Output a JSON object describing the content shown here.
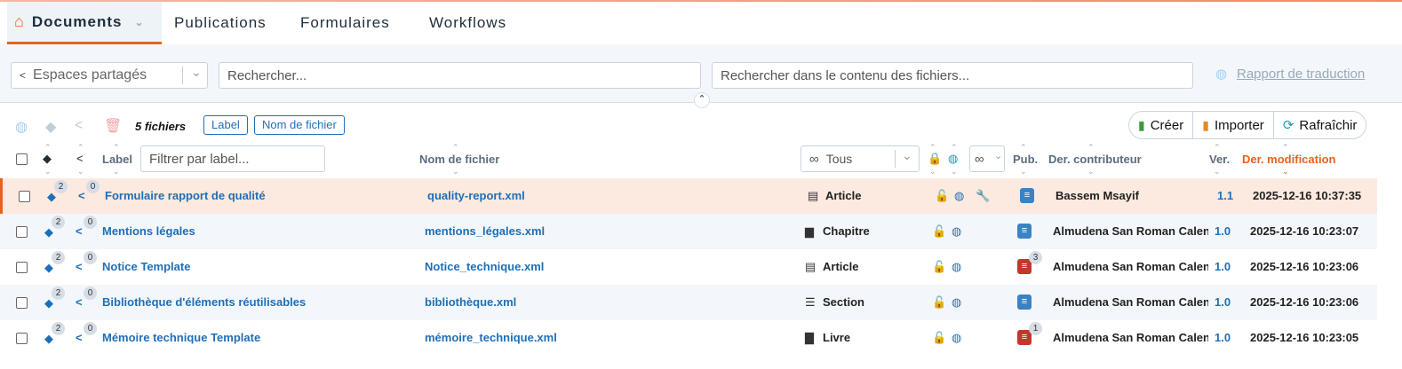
{
  "nav": {
    "tabs": [
      {
        "label": "Documents"
      },
      {
        "label": "Publications"
      },
      {
        "label": "Formulaires"
      },
      {
        "label": "Workflows"
      }
    ]
  },
  "toolbar": {
    "space_placeholder": "Espaces partagés",
    "search_placeholder": "Rechercher...",
    "content_search_placeholder": "Rechercher dans le contenu des fichiers...",
    "translation_report": "Rapport de traduction"
  },
  "list": {
    "count_label": "5 fichiers",
    "pill_label": "Label",
    "pill_filename": "Nom de fichier",
    "create": "Créer",
    "import": "Importer",
    "refresh": "Rafraîchir"
  },
  "columns": {
    "label": "Label",
    "label_filter_placeholder": "Filtrer par label...",
    "filename": "Nom de fichier",
    "type_filter": "Tous",
    "pub": "Pub.",
    "contributor": "Der. contributeur",
    "version": "Ver.",
    "modified": "Der. modification"
  },
  "rows": [
    {
      "tags": "2",
      "shares": "0",
      "label": "Formulaire rapport de qualité",
      "file": "quality-report.xml",
      "type": "Article",
      "pub_count": "",
      "contributor": "Bassem Msayif",
      "version": "1.1",
      "modified": "2025-12-16 10:37:35"
    },
    {
      "tags": "2",
      "shares": "0",
      "label": "Mentions légales",
      "file": "mentions_légales.xml",
      "type": "Chapitre",
      "pub_count": "",
      "contributor": "Almudena San Roman Calencc",
      "version": "1.0",
      "modified": "2025-12-16 10:23:07"
    },
    {
      "tags": "2",
      "shares": "0",
      "label": "Notice Template",
      "file": "Notice_technique.xml",
      "type": "Article",
      "pub_count": "3",
      "contributor": "Almudena San Roman Calencc",
      "version": "1.0",
      "modified": "2025-12-16 10:23:06"
    },
    {
      "tags": "2",
      "shares": "0",
      "label": "Bibliothèque d'éléments réutilisables",
      "file": "bibliothèque.xml",
      "type": "Section",
      "pub_count": "",
      "contributor": "Almudena San Roman Calencc",
      "version": "1.0",
      "modified": "2025-12-16 10:23:06"
    },
    {
      "tags": "2",
      "shares": "0",
      "label": "Mémoire technique Template",
      "file": "mémoire_technique.xml",
      "type": "Livre",
      "pub_count": "1",
      "contributor": "Almudena San Roman Calencc",
      "version": "1.0",
      "modified": "2025-12-16 10:23:05"
    }
  ],
  "colors": {
    "accent": "#e8621a",
    "link": "#1f6fb8",
    "selected_row": "#fce9df",
    "alt_row": "#f3f7fb"
  }
}
